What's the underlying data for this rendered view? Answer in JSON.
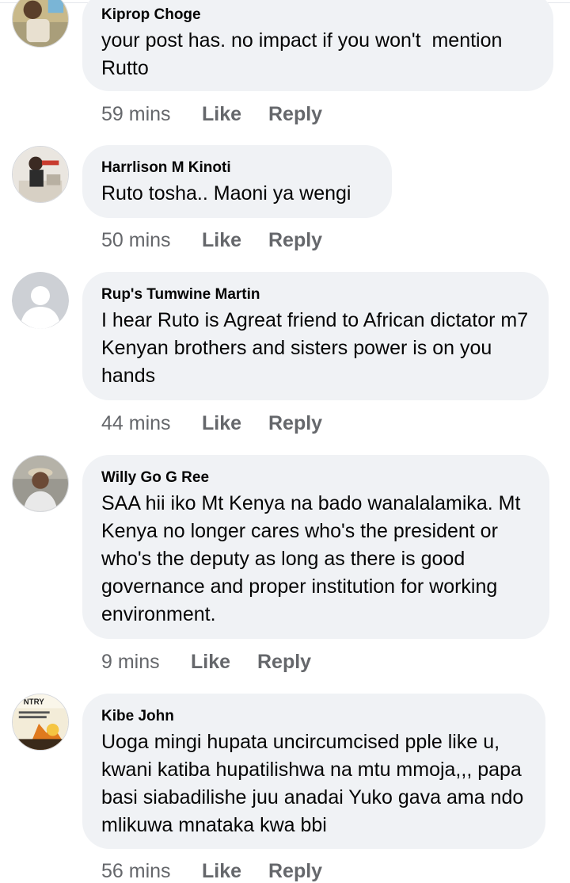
{
  "comments": [
    {
      "author": "Kiprop Choge",
      "text": "your post has. no impact if you won't  mention Rutto",
      "time": "59 mins",
      "like": "Like",
      "reply": "Reply"
    },
    {
      "author": "Harrlison M Kinoti",
      "text": "Ruto tosha.. Maoni ya wengi",
      "time": "50 mins",
      "like": "Like",
      "reply": "Reply"
    },
    {
      "author": "Rup's Tumwine Martin",
      "text": "I hear Ruto is Agreat friend to African dictator m7 Kenyan brothers and sisters power is on you hands",
      "time": "44 mins",
      "like": "Like",
      "reply": "Reply"
    },
    {
      "author": "Willy Go G Ree",
      "text": "SAA hii iko Mt Kenya na bado wanalalamika. Mt Kenya no longer cares who's the president or who's the deputy as long as there is good governance and proper institution for working environment.",
      "time": "9 mins",
      "like": "Like",
      "reply": "Reply"
    },
    {
      "author": "Kibe John",
      "text": "Uoga mingi hupata uncircumcised pple like u, kwani katiba hupatilishwa na mtu mmoja,,, papa basi siabadilishe juu anadai Yuko gava ama ndo mlikuwa mnataka kwa bbi",
      "time": "56 mins",
      "like": "Like",
      "reply": "Reply"
    }
  ],
  "avatar_art_text": "NTRY"
}
